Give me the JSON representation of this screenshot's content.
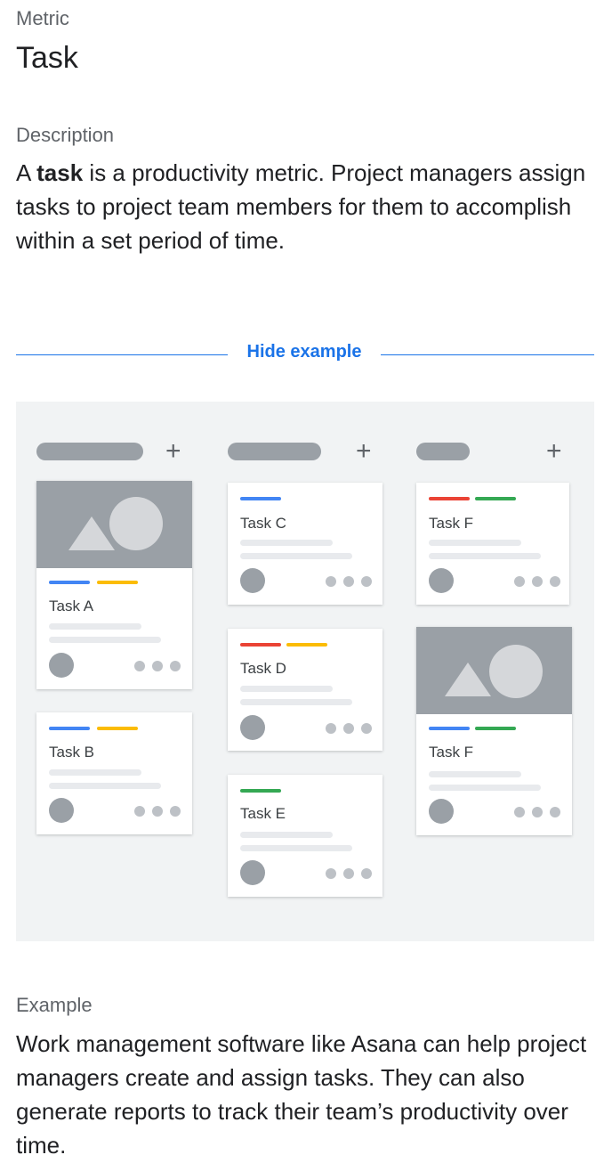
{
  "metric": {
    "label": "Metric",
    "name": "Task"
  },
  "description": {
    "label": "Description",
    "prefix": "A ",
    "bold": "task",
    "suffix": " is a productivity metric. Project managers assign tasks to project team members for them to accomplish within a set period of time."
  },
  "toggle": {
    "label": "Hide example"
  },
  "board": {
    "add_symbol": "+",
    "cards": {
      "a": "Task A",
      "b": "Task B",
      "c": "Task C",
      "d": "Task D",
      "e": "Task E",
      "f1": "Task F",
      "f2": "Task F"
    }
  },
  "example": {
    "label": "Example",
    "text": "Work management software like Asana can help project managers create and assign tasks. They can also generate reports to track their team’s productivity over time."
  },
  "colors": {
    "accent": "#1a73e8",
    "tag_blue": "#4285f4",
    "tag_yellow": "#fbbc04",
    "tag_red": "#ea4335",
    "tag_green": "#34a853"
  }
}
